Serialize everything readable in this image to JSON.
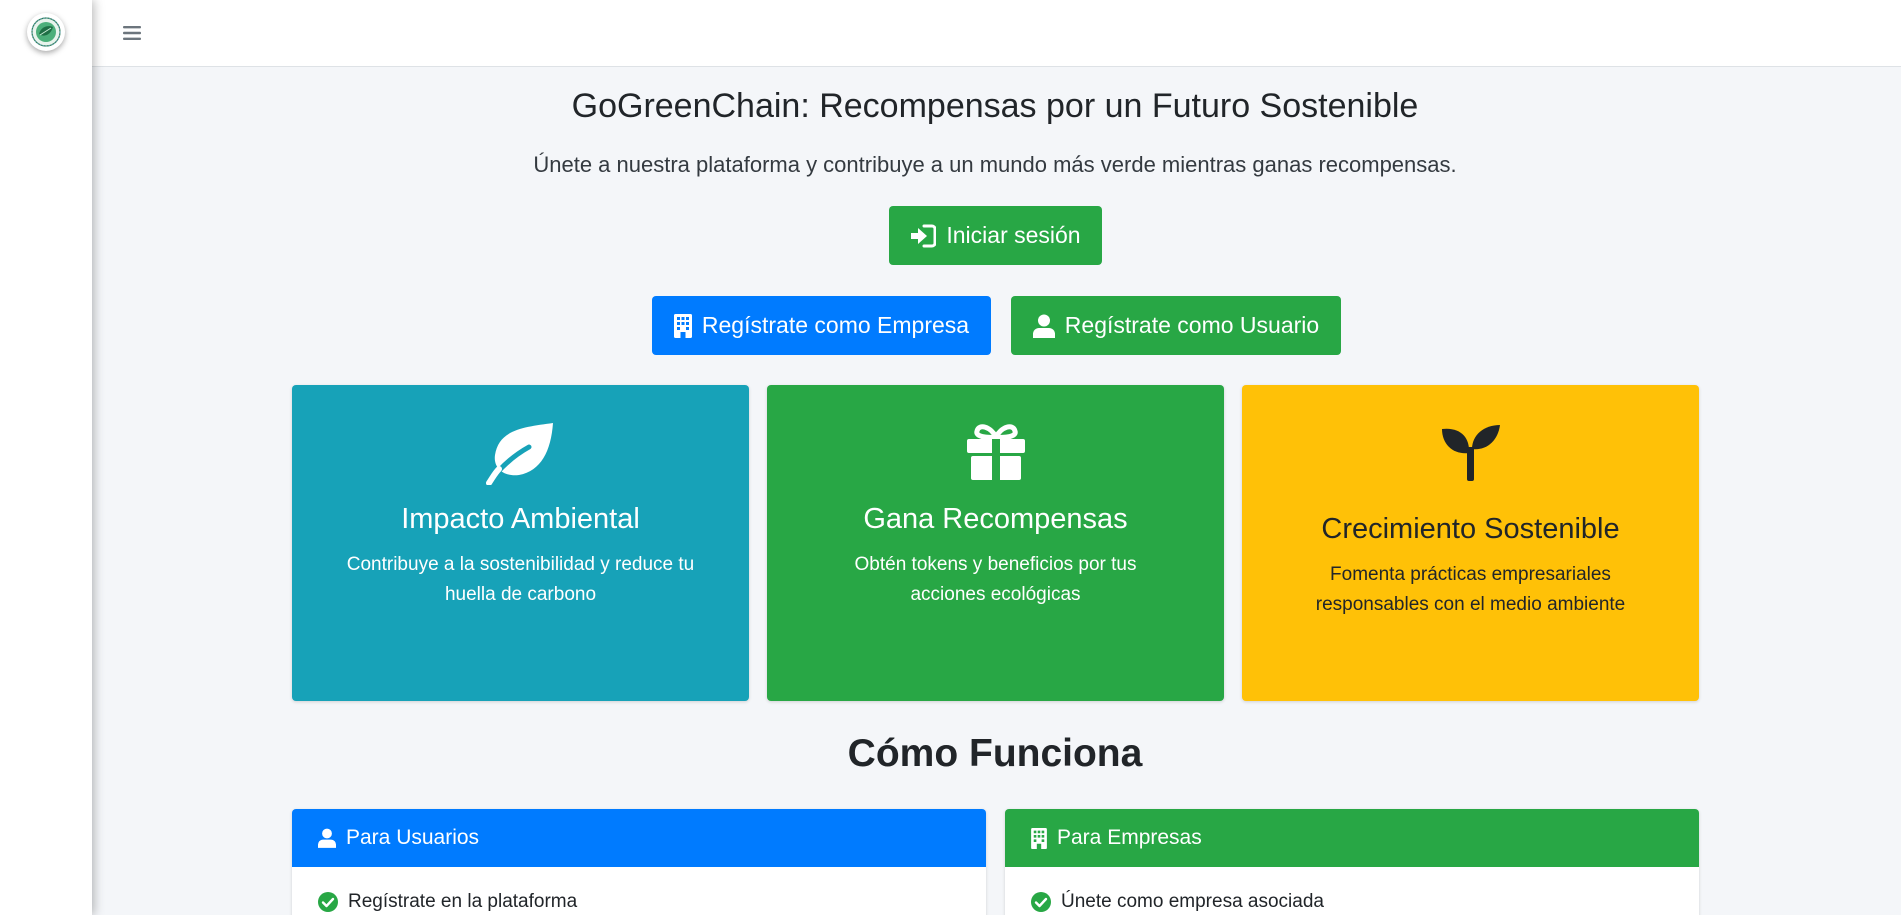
{
  "sidebar": {
    "logo_icon": "globe-leaf-logo-icon"
  },
  "navbar": {
    "menu_icon": "hamburger-menu-icon"
  },
  "hero": {
    "title": "GoGreenChain: Recompensas por un Futuro Sostenible",
    "subtitle": "Únete a nuestra plataforma y contribuye a un mundo más verde mientras ganas recompensas.",
    "login_label": "Iniciar sesión",
    "register_company_label": "Regístrate como Empresa",
    "register_user_label": "Regístrate como Usuario"
  },
  "features": [
    {
      "icon": "leaf-icon",
      "title": "Impacto Ambiental",
      "description": "Contribuye a la sostenibilidad y reduce tu huella de carbono",
      "color": "#17a2b8"
    },
    {
      "icon": "gift-icon",
      "title": "Gana Recompensas",
      "description": "Obtén tokens y beneficios por tus acciones ecológicas",
      "color": "#28a745"
    },
    {
      "icon": "seedling-icon",
      "title": "Crecimiento Sostenible",
      "description": "Fomenta prácticas empresariales responsables con el medio ambiente",
      "color": "#ffc107"
    }
  ],
  "how_it_works": {
    "title": "Cómo Funciona",
    "users": {
      "header": "Para Usuarios",
      "items": [
        "Regístrate en la plataforma"
      ]
    },
    "companies": {
      "header": "Para Empresas",
      "items": [
        "Únete como empresa asociada"
      ]
    }
  },
  "colors": {
    "primary": "#007bff",
    "success": "#28a745",
    "info": "#17a2b8",
    "warning": "#ffc107",
    "background": "#f4f6f9"
  }
}
